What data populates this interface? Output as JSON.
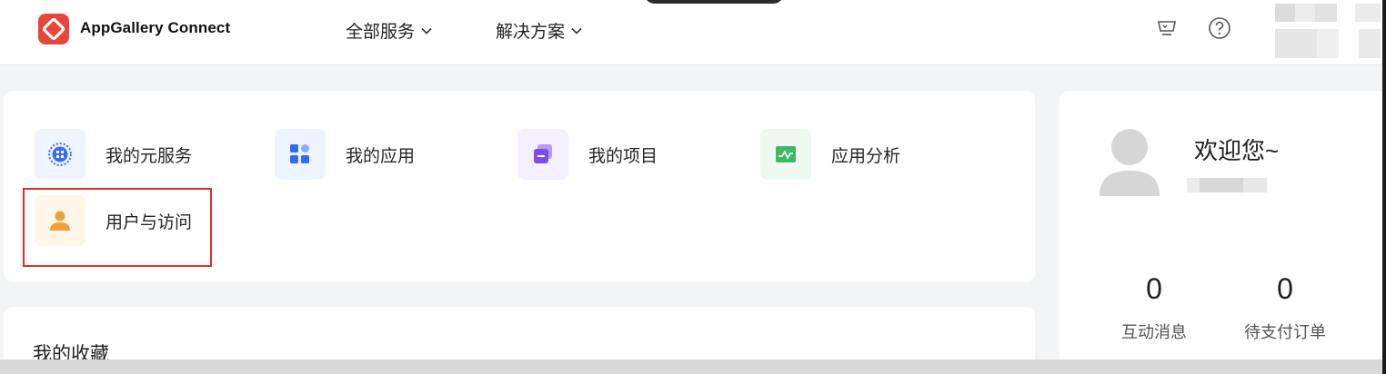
{
  "header": {
    "brand": "AppGallery Connect",
    "nav": [
      {
        "label": "全部服务"
      },
      {
        "label": "解决方案"
      }
    ],
    "icons": [
      "store-icon",
      "help-icon"
    ]
  },
  "shortcuts": [
    {
      "label": "我的元服务",
      "icon": "atomic-service-icon",
      "color": "#3b6cf6",
      "bg": "#f0f4ff"
    },
    {
      "label": "我的应用",
      "icon": "apps-grid-icon",
      "color": "#2f6bf0",
      "bg": "#eef4ff"
    },
    {
      "label": "我的项目",
      "icon": "project-stack-icon",
      "color": "#7b4ee6",
      "bg": "#f4f0ff"
    },
    {
      "label": "应用分析",
      "icon": "analytics-chart-icon",
      "color": "#3fb86a",
      "bg": "#eef9f1"
    },
    {
      "label": "用户与访问",
      "icon": "user-icon",
      "color": "#f0a23a",
      "bg": "#fff6ea"
    }
  ],
  "favorites": {
    "title": "我的收藏"
  },
  "profile": {
    "welcome": "欢迎您~",
    "stats": [
      {
        "value": "0",
        "label": "互动消息"
      },
      {
        "value": "0",
        "label": "待支付订单"
      }
    ]
  },
  "colors": {
    "accent": "#e8453c",
    "highlight": "#d93026"
  }
}
